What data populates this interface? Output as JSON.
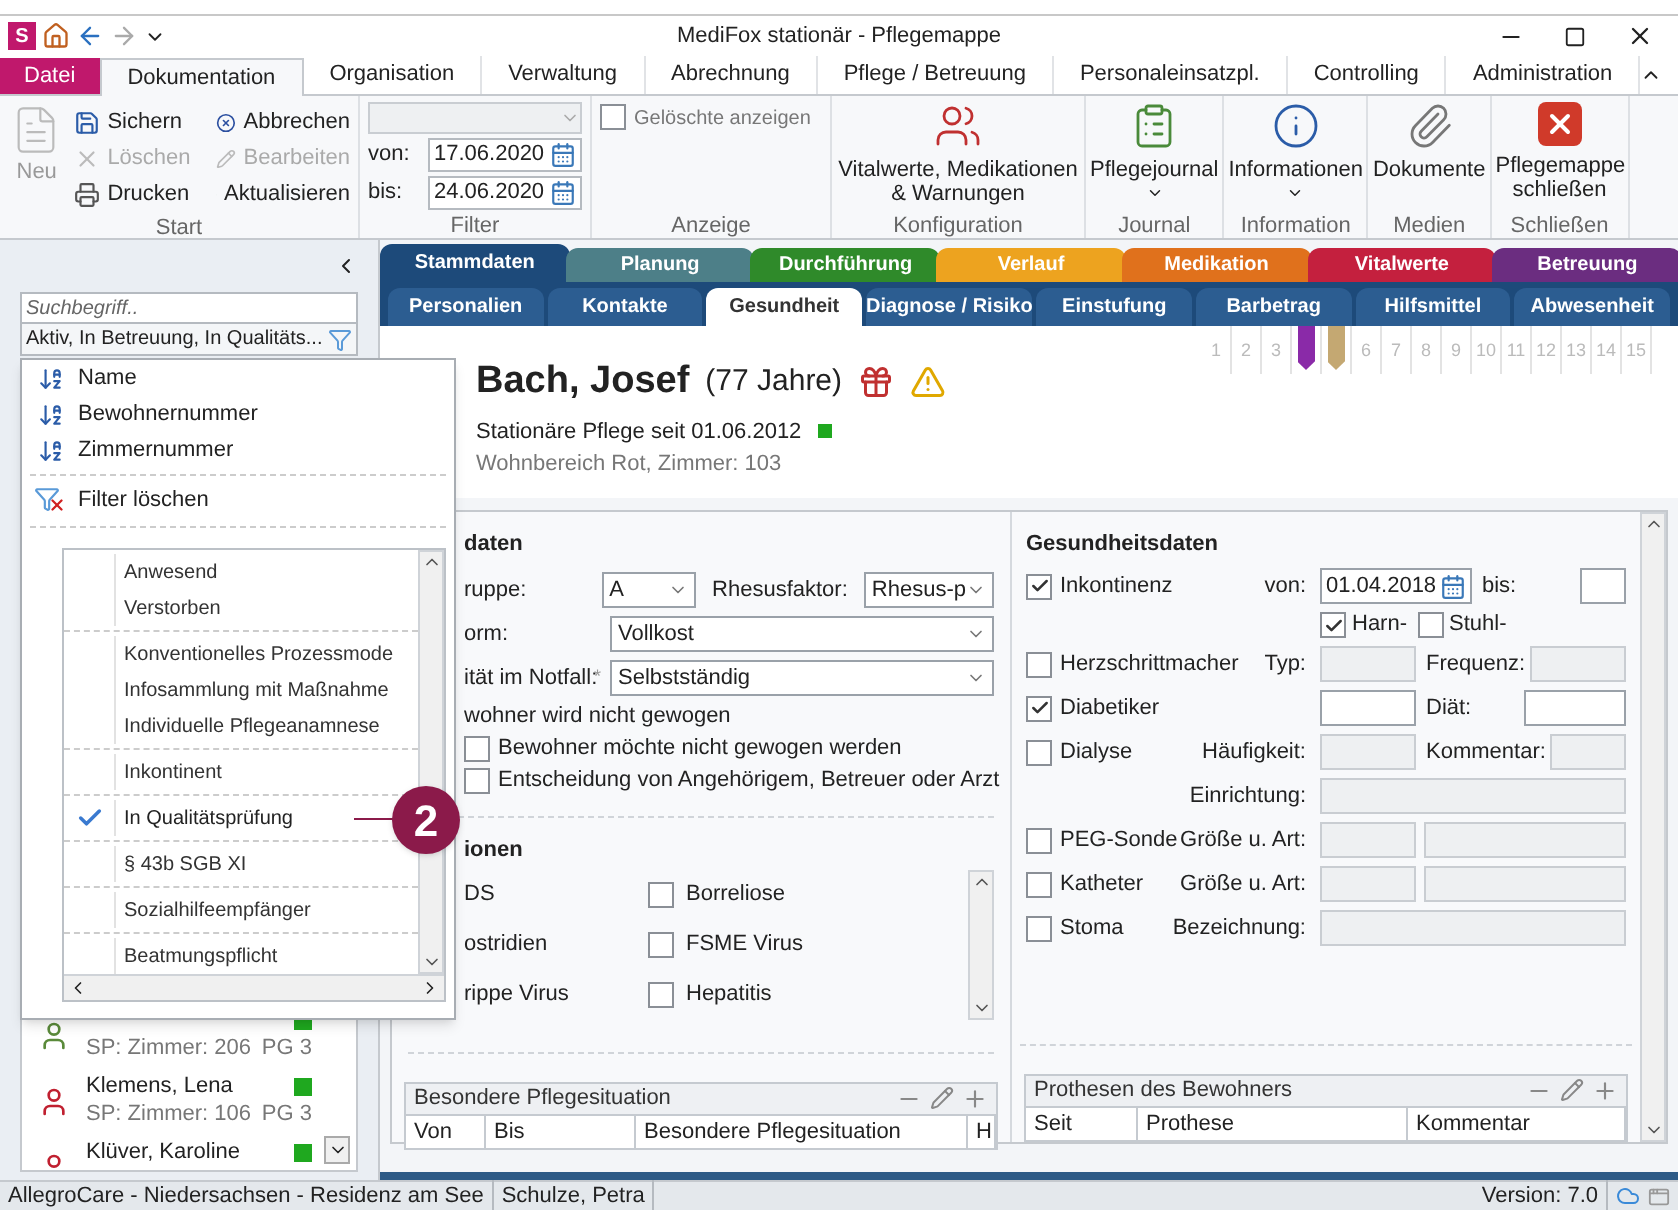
{
  "app_logo": "S",
  "window": {
    "title": "MediFox stationär - Pflegemappe"
  },
  "ribbon_tabs": [
    {
      "label": "Datei",
      "kind": "file",
      "selected": false
    },
    {
      "label": "Dokumentation",
      "kind": "tab",
      "selected": true
    },
    {
      "label": "Organisation",
      "kind": "tab",
      "selected": false
    },
    {
      "label": "Verwaltung",
      "kind": "tab",
      "selected": false
    },
    {
      "label": "Abrechnung",
      "kind": "tab",
      "selected": false
    },
    {
      "label": "Pflege / Betreuung",
      "kind": "tab",
      "selected": false
    },
    {
      "label": "Personaleinsatzpl.",
      "kind": "tab",
      "selected": false
    },
    {
      "label": "Controlling",
      "kind": "tab",
      "selected": false
    },
    {
      "label": "Administration",
      "kind": "tab",
      "selected": false
    }
  ],
  "start_group": {
    "label": "Start",
    "new_button": {
      "label": "Neu",
      "disabled": true
    },
    "buttons": [
      {
        "label": "Sichern",
        "disabled": false
      },
      {
        "label": "Löschen",
        "disabled": true
      },
      {
        "label": "Drucken",
        "disabled": false
      },
      {
        "label": "Abbrechen",
        "disabled": false
      },
      {
        "label": "Bearbeiten",
        "disabled": true
      },
      {
        "label": "Aktualisieren",
        "disabled": false
      }
    ]
  },
  "filter_group": {
    "label": "Filter",
    "select": {
      "disabled": true
    },
    "from": {
      "label": "von:",
      "value": "17.06.2020"
    },
    "to": {
      "label": "bis:",
      "value": "24.06.2020"
    }
  },
  "display_group": {
    "label": "Anzeige",
    "show_deleted": {
      "label": "Gelöschte anzeigen",
      "checked": false
    }
  },
  "large_groups": [
    {
      "label": "Konfiguration",
      "button": "Vitalwerte, Medikationen & Warnungen",
      "menu": false
    },
    {
      "label": "Journal",
      "button": "Pflegejournal",
      "menu": true
    },
    {
      "label": "Information",
      "button": "Informationen",
      "menu": true
    },
    {
      "label": "Medien",
      "button": "Dokumente",
      "menu": false
    },
    {
      "label": "Schließen",
      "button": "Pflegemappe schließen",
      "menu": false
    }
  ],
  "left_panel": {
    "search": {
      "placeholder": "Suchbegriff.."
    },
    "filter_field": {
      "value": "Aktiv, In Betreuung, In Qualitäts..."
    },
    "residents": [
      {
        "kind": "male",
        "room": "SP: Zimmer: 206",
        "grade": "PG 3",
        "color": "#1fa81f"
      },
      {
        "kind": "female",
        "name": "Klemens, Lena",
        "room": "SP: Zimmer: 106",
        "grade": "PG 3",
        "color": "#1fa81f"
      },
      {
        "kind": "female",
        "name": "Klüver, Karoline",
        "color": "#1fa81f"
      }
    ]
  },
  "filter_menu": {
    "sort_items": [
      "Name",
      "Bewohnernummer",
      "Zimmernummer"
    ],
    "clear": "Filter löschen",
    "groups": [
      [
        {
          "label": "Anwesend",
          "checked": false
        },
        {
          "label": "Verstorben",
          "checked": false
        }
      ],
      [
        {
          "label": "Konventionelles Prozessmode",
          "checked": false
        },
        {
          "label": "Infosammlung mit Maßnahme",
          "checked": false
        },
        {
          "label": "Individuelle Pflegeanamnese",
          "checked": false
        }
      ],
      [
        {
          "label": "Inkontinent",
          "checked": false
        }
      ],
      [
        {
          "label": "In Qualitätsprüfung",
          "checked": true
        }
      ],
      [
        {
          "label": "§ 43b SGB XI",
          "checked": false
        }
      ],
      [
        {
          "label": "Sozialhilfeempfänger",
          "checked": false
        }
      ],
      [
        {
          "label": "Beatmungspflicht",
          "checked": false
        }
      ]
    ]
  },
  "callout": {
    "text": "2"
  },
  "module_tabs": [
    {
      "label": "Stammdaten",
      "color": "#1d4a7a",
      "selected": true
    },
    {
      "label": "Planung",
      "color": "#4d7f88",
      "selected": false
    },
    {
      "label": "Durchführung",
      "color": "#2f8a2a",
      "selected": false
    },
    {
      "label": "Verlauf",
      "color": "#eda31f",
      "selected": false
    },
    {
      "label": "Medikation",
      "color": "#e0711c",
      "selected": false
    },
    {
      "label": "Vitalwerte",
      "color": "#c4203e",
      "selected": false
    },
    {
      "label": "Betreuung",
      "color": "#6b2d80",
      "selected": false
    }
  ],
  "sub_tabs": [
    {
      "label": "Personalien",
      "selected": false
    },
    {
      "label": "Kontakte",
      "selected": false
    },
    {
      "label": "Gesundheit",
      "selected": true
    },
    {
      "label": "Diagnose / Risiko",
      "selected": false
    },
    {
      "label": "Einstufung",
      "selected": false
    },
    {
      "label": "Barbetrag",
      "selected": false
    },
    {
      "label": "Hilfsmittel",
      "selected": false
    },
    {
      "label": "Abwesenheit",
      "selected": false
    }
  ],
  "resident": {
    "name": "Bach, Josef",
    "age": "(77 Jahre)",
    "care": "Stationäre Pflege seit 01.06.2012",
    "color": "#1fa81f",
    "location": "Wohnbereich Rot, Zimmer: 103"
  },
  "pages": [
    {
      "kind": "number",
      "text": "1"
    },
    {
      "kind": "number",
      "text": "2"
    },
    {
      "kind": "number",
      "text": "3"
    },
    {
      "kind": "bookmark",
      "color": "#8a2aa8"
    },
    {
      "kind": "bookmark",
      "color": "#c4a872"
    },
    {
      "kind": "number",
      "text": "6"
    },
    {
      "kind": "number",
      "text": "7"
    },
    {
      "kind": "number",
      "text": "8"
    },
    {
      "kind": "number",
      "text": "9"
    },
    {
      "kind": "number",
      "text": "10"
    },
    {
      "kind": "number",
      "text": "11"
    },
    {
      "kind": "number",
      "text": "12"
    },
    {
      "kind": "number",
      "text": "13"
    },
    {
      "kind": "number",
      "text": "14"
    },
    {
      "kind": "number",
      "text": "15"
    }
  ],
  "left_form": {
    "heading": "daten",
    "rows": [
      {
        "label": "ruppe:",
        "select": "A",
        "label2": "Rhesusfaktor:",
        "select2": "Rhesus-p"
      },
      {
        "label": "orm:",
        "select": "Vollkost"
      },
      {
        "label": "ität im Notfall:",
        "marker": "*",
        "select": "Selbstständig"
      }
    ],
    "weight_options": [
      {
        "kind": "text",
        "label": "wohner wird nicht gewogen"
      },
      {
        "kind": "check",
        "label": "Bewohner möchte nicht gewogen werden",
        "checked": false
      },
      {
        "kind": "check",
        "label": "Entscheidung von Angehörigem, Betreuer oder Arzt",
        "checked": false
      }
    ],
    "infections_heading": "ionen",
    "infections": [
      {
        "left": "DS",
        "right": {
          "label": "Borreliose",
          "checked": false
        }
      },
      {
        "left": "ostridien",
        "right": {
          "label": "FSME Virus",
          "checked": false
        }
      },
      {
        "left": "rippe Virus",
        "right": {
          "label": "Hepatitis",
          "checked": false
        }
      }
    ],
    "table": {
      "title": "Besondere Pflegesituation",
      "columns": [
        "Von",
        "Bis",
        "Besondere Pflegesituation",
        "H"
      ]
    }
  },
  "right_form": {
    "heading": "Gesundheitsdaten",
    "rows": [
      {
        "check": {
          "label": "Inkontinenz",
          "checked": true
        },
        "label": "von:",
        "field": {
          "kind": "date",
          "value": "01.04.2018",
          "disabled": false
        },
        "label2": "bis:",
        "field2": {
          "kind": "text",
          "disabled": false
        }
      },
      {
        "subchecks": [
          {
            "label": "Harn-",
            "checked": true
          },
          {
            "label": "Stuhl-",
            "checked": false
          }
        ]
      },
      {
        "check": {
          "label": "Herzschrittmacher",
          "checked": false
        },
        "label": "Typ:",
        "field": {
          "kind": "text",
          "disabled": true
        },
        "label2": "Frequenz:",
        "field2": {
          "kind": "text",
          "disabled": true
        }
      },
      {
        "check": {
          "label": "Diabetiker",
          "checked": true
        },
        "field": {
          "kind": "text",
          "disabled": false
        },
        "label2": "Diät:",
        "field2": {
          "kind": "text",
          "disabled": false
        }
      },
      {
        "check": {
          "label": "Dialyse",
          "checked": false
        },
        "label": "Häufigkeit:",
        "field": {
          "kind": "text",
          "disabled": true
        },
        "label2": "Kommentar:",
        "field2": {
          "kind": "text",
          "disabled": true
        }
      },
      {
        "label": "Einrichtung:",
        "field": {
          "kind": "wide",
          "disabled": true
        }
      },
      {
        "check": {
          "label": "PEG-Sonde",
          "checked": false
        },
        "label": "Größe u. Art:",
        "field": {
          "kind": "text",
          "disabled": true
        },
        "field2": {
          "kind": "text",
          "disabled": true
        }
      },
      {
        "check": {
          "label": "Katheter",
          "checked": false
        },
        "label": "Größe u. Art:",
        "field": {
          "kind": "text",
          "disabled": true
        },
        "field2": {
          "kind": "text",
          "disabled": true
        }
      },
      {
        "check": {
          "label": "Stoma",
          "checked": false
        },
        "label": "Bezeichnung:",
        "field": {
          "kind": "wide",
          "disabled": true
        }
      }
    ],
    "table": {
      "title": "Prothesen des Bewohners",
      "columns": [
        "Seit",
        "Prothese",
        "Kommentar"
      ]
    }
  },
  "status_bar": {
    "facility": "AllegroCare - Niedersachsen - Residenz am See",
    "user": "Schulze, Petra",
    "version": "Version: 7.0"
  }
}
